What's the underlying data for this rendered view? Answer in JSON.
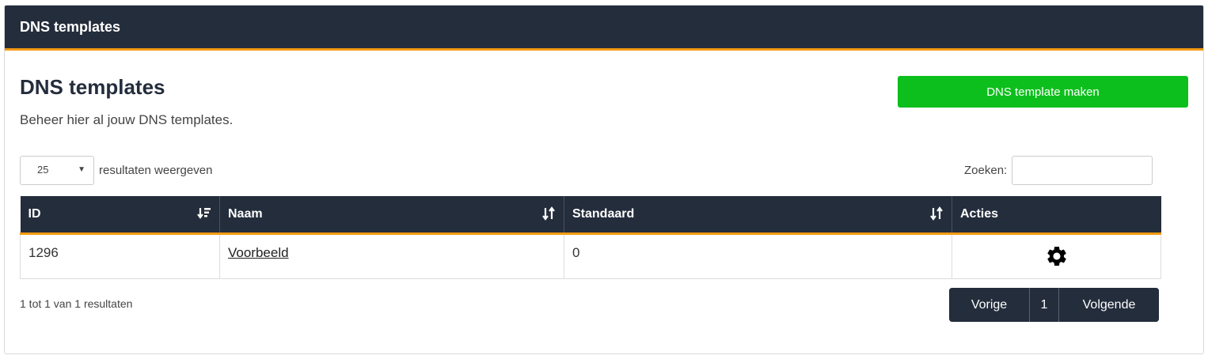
{
  "header": {
    "title": "DNS templates"
  },
  "main": {
    "title": "DNS templates",
    "description": "Beheer hier al jouw DNS templates.",
    "create_button": "DNS template maken"
  },
  "controls": {
    "length_value": "25",
    "length_label": "resultaten weergeven",
    "search_label": "Zoeken:",
    "search_value": ""
  },
  "table": {
    "columns": [
      "ID",
      "Naam",
      "Standaard",
      "Acties"
    ],
    "rows": [
      {
        "id": "1296",
        "name": "Voorbeeld",
        "standard": "0",
        "action_icon": "gear-icon"
      }
    ]
  },
  "footer": {
    "info": "1 tot 1 van 1 resultaten",
    "prev": "Vorige",
    "page": "1",
    "next": "Volgende"
  },
  "colors": {
    "header_bg": "#242d3c",
    "accent": "#f39a12",
    "create_button": "#0dbf1c"
  }
}
